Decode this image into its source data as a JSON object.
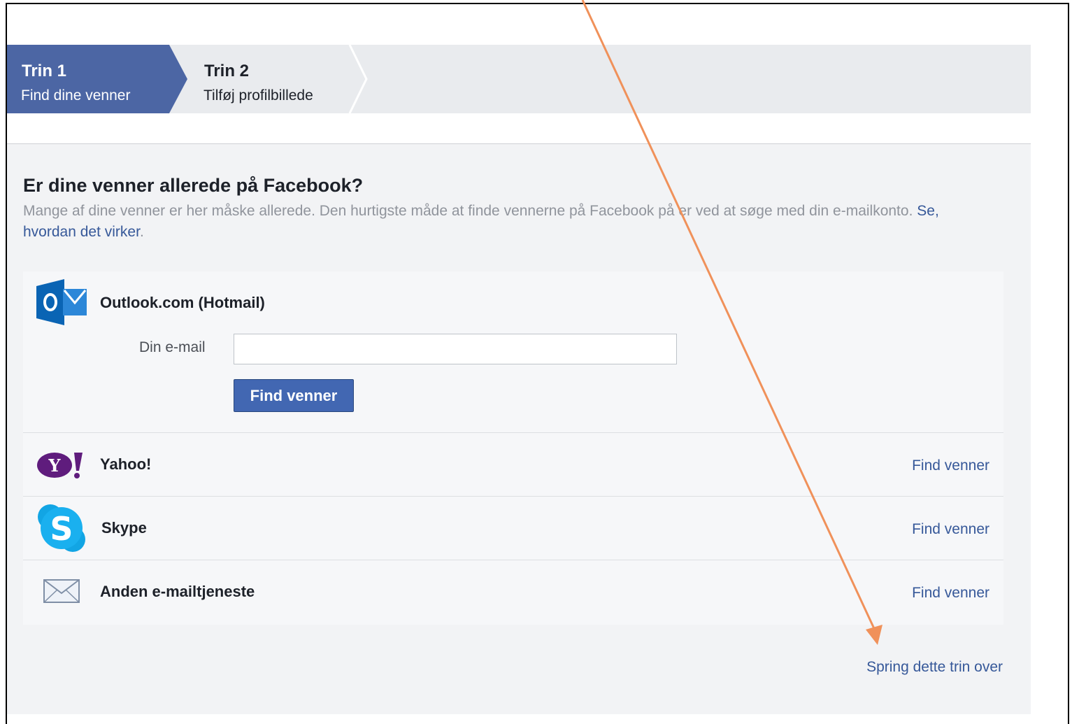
{
  "steps": [
    {
      "title": "Trin 1",
      "subtitle": "Find dine venner"
    },
    {
      "title": "Trin 2",
      "subtitle": "Tilføj profilbillede"
    }
  ],
  "heading": "Er dine venner allerede på Facebook?",
  "description": "Mange af dine venner er her måske allerede. Den hurtigste måde at finde vennerne på Facebook på er ved at søge med din e-mailkonto.",
  "how_link": "Se, hvordan det virker",
  "providers": {
    "outlook": {
      "name": "Outlook.com (Hotmail)",
      "email_label": "Din e-mail",
      "email_value": "",
      "button": "Find venner"
    },
    "yahoo": {
      "name": "Yahoo!",
      "link": "Find venner"
    },
    "skype": {
      "name": "Skype",
      "link": "Find venner"
    },
    "other": {
      "name": "Anden e-mailtjeneste",
      "link": "Find venner"
    }
  },
  "skip_link": "Spring dette trin over",
  "colors": {
    "accent": "#4267b2",
    "link": "#365899",
    "annotation_arrow": "#f0915a"
  }
}
